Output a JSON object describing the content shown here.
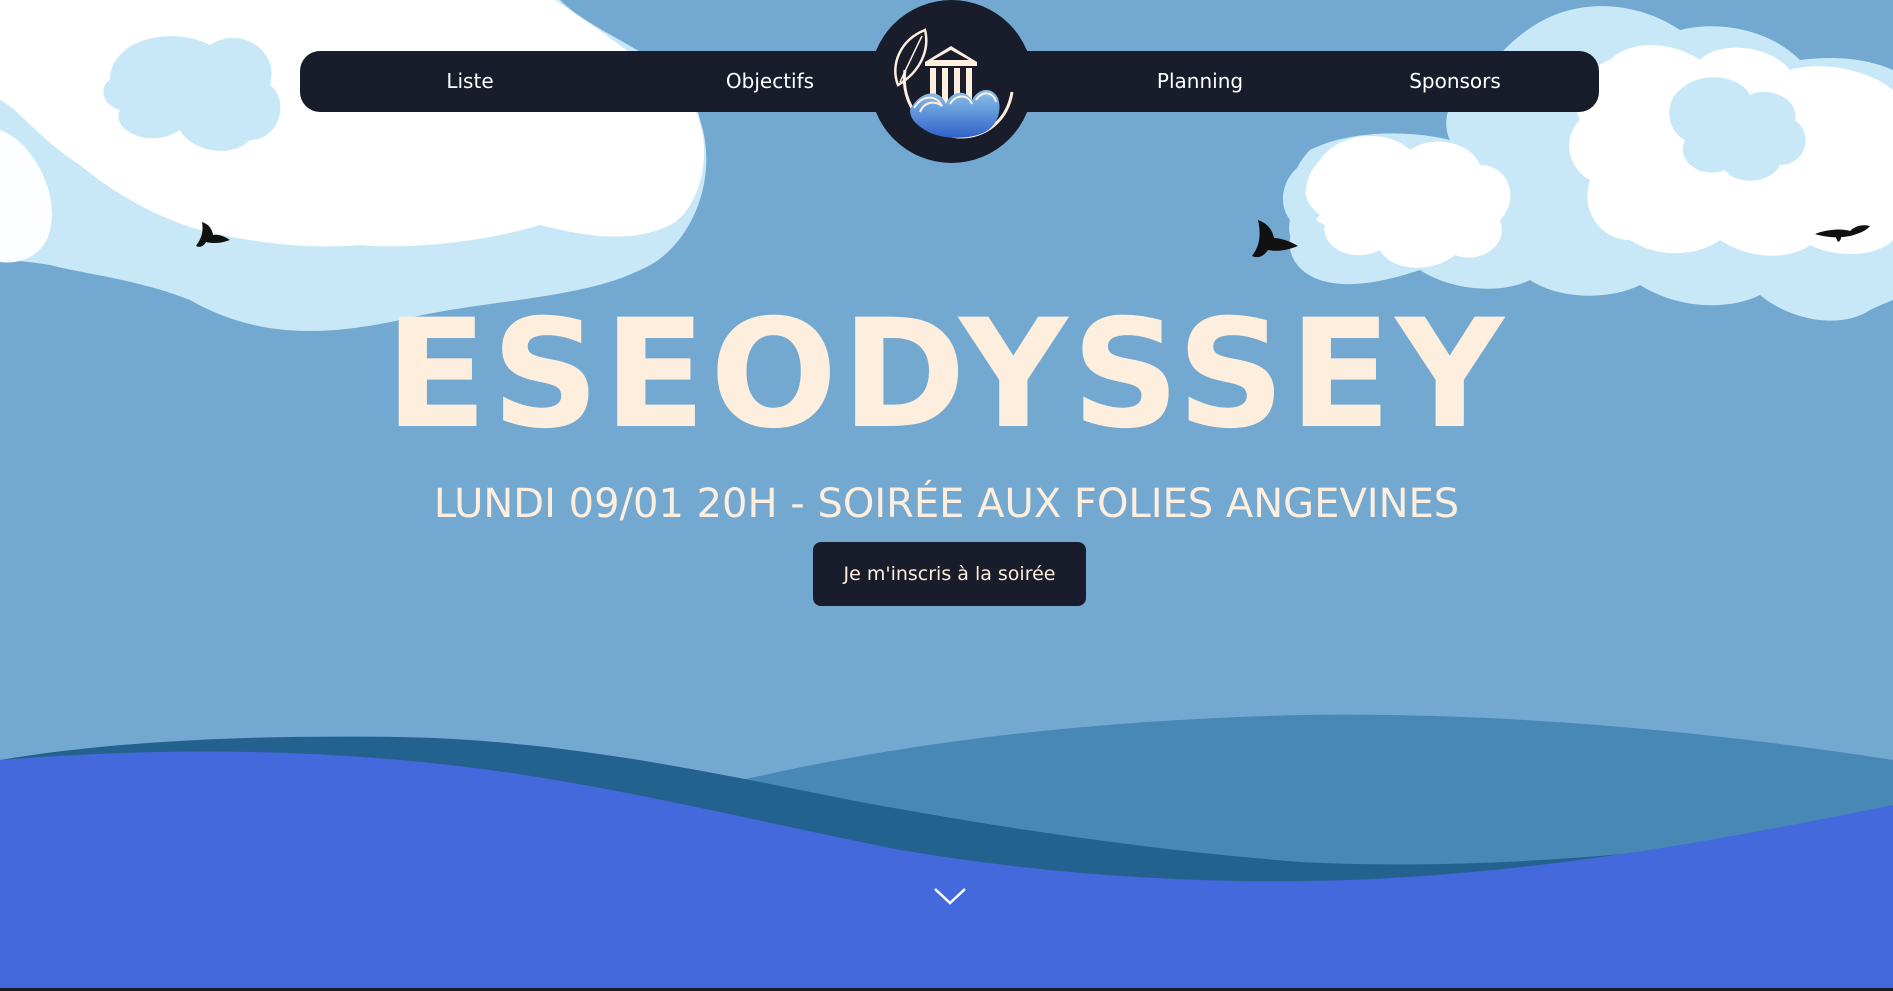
{
  "nav": {
    "items": [
      {
        "label": "Liste"
      },
      {
        "label": "Objectifs"
      },
      {
        "label": "Planning"
      },
      {
        "label": "Sponsors"
      }
    ]
  },
  "hero": {
    "title": "ESEODYSSEY",
    "subtitle": "LUNDI 09/01 20H - SOIRÉE AUX FOLIES ANGEVINES",
    "cta_label": "Je m'inscris à la soirée"
  },
  "icons": {
    "logo": "temple-waves-logo-icon",
    "scroll": "chevron-down-icon",
    "birds": "bird-icon"
  },
  "colors": {
    "sky": "#73a9d1",
    "navy": "#181c2b",
    "cream": "#fdeedd",
    "cloud_white": "#ffffff",
    "cloud_light": "#c8e8f7",
    "sea_front": "#4369dc",
    "sea_mid": "#23628f",
    "sea_back": "#4788b4"
  }
}
